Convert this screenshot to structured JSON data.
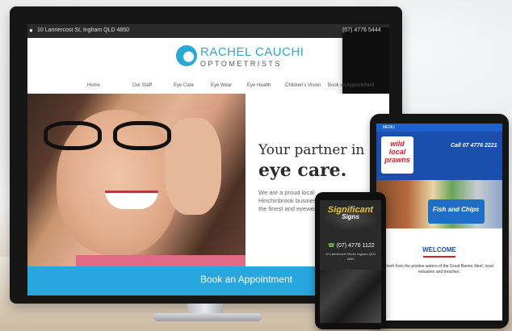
{
  "desktop": {
    "topbar": {
      "address": "10 Lannercost St, Ingham QLD 4850",
      "phone": "(07) 4776 5444"
    },
    "logo": {
      "name": "RACHEL CAUCHI",
      "subtitle": "OPTOMETRISTS"
    },
    "nav": [
      "Home",
      "Our Staff",
      "Eye Care",
      "Eye Wear",
      "Eye Health",
      "Children's Vision",
      "Book an Appointment"
    ],
    "hero": {
      "tagline_line1": "Your partner in",
      "tagline_line2": "eye care.",
      "description": "We are a proud local Hinchinbrook business providing the finest and eyewear"
    },
    "book_button": "Book an Appointment"
  },
  "tablet": {
    "menu_label": "MENU",
    "logo_text": "wild local prawns",
    "call_text": "Call 07 4776 2221",
    "banner_text": "Fish and Chips",
    "welcome_heading": "WELCOME",
    "body_text": "fresh from the pristine waters of the Great Barrier Reef, local estuaries and beaches."
  },
  "phone": {
    "logo_line1": "Significant",
    "logo_line2": "Signs",
    "phone_number": "(07) 4776 1122",
    "address": "10 Lannercost Street, Ingham QLD 4850"
  },
  "colors": {
    "brand_blue": "#27a7dd",
    "tablet_blue": "#1b4fae",
    "sign_gold": "#e7c43a"
  }
}
